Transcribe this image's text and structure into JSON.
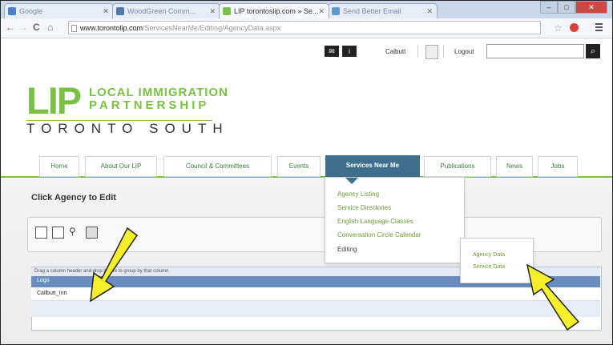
{
  "browser": {
    "tabs": [
      {
        "label": "Google",
        "active": false
      },
      {
        "label": "WoodGreen Comm...",
        "active": false
      },
      {
        "label": "LIP torontoslip.com » Se...",
        "active": true
      },
      {
        "label": "Send Better Email",
        "active": false
      }
    ],
    "address_host": "www.torontolip.com",
    "address_path": "/ServicesNearMe/Editing/AgencyData.aspx",
    "window_controls": {
      "minimize": "–",
      "maximize": "□",
      "close": "✕"
    }
  },
  "site_top": {
    "user_label": "Calbutt",
    "logout_label": "Logout",
    "search_placeholder": ""
  },
  "logo": {
    "mark": "LIP",
    "line1": "LOCAL IMMIGRATION",
    "line2": "PARTNERSHIP",
    "line3": "TORONTO SOUTH"
  },
  "nav": [
    {
      "label": "Home",
      "active": false
    },
    {
      "label": "About Our LIP",
      "active": false
    },
    {
      "label": "Council & Committees",
      "active": false
    },
    {
      "label": "Events",
      "active": false
    },
    {
      "label": "Services Near Me",
      "active": true
    },
    {
      "label": "Publications",
      "active": false
    },
    {
      "label": "News",
      "active": false
    },
    {
      "label": "Jobs",
      "active": false
    }
  ],
  "dropdown": {
    "items": [
      "Agency Listing",
      "Service Directories",
      "English Language Classes",
      "Conversation Circle Calendar",
      "Editing"
    ]
  },
  "submenu": {
    "items": [
      "Agency Data",
      "Service Data"
    ]
  },
  "page": {
    "title": "Click Agency to Edit"
  },
  "grid": {
    "group_hint": "Drag a column header and drop it here to group by that column",
    "column_header": "Logo",
    "rows": [
      "Callbutt_Inn"
    ]
  },
  "colors": {
    "brand_green": "#7ac143",
    "nav_active": "#3e6f8e",
    "grid_header": "#6a8dc0",
    "annotation_arrow": "#f5ee2a"
  }
}
